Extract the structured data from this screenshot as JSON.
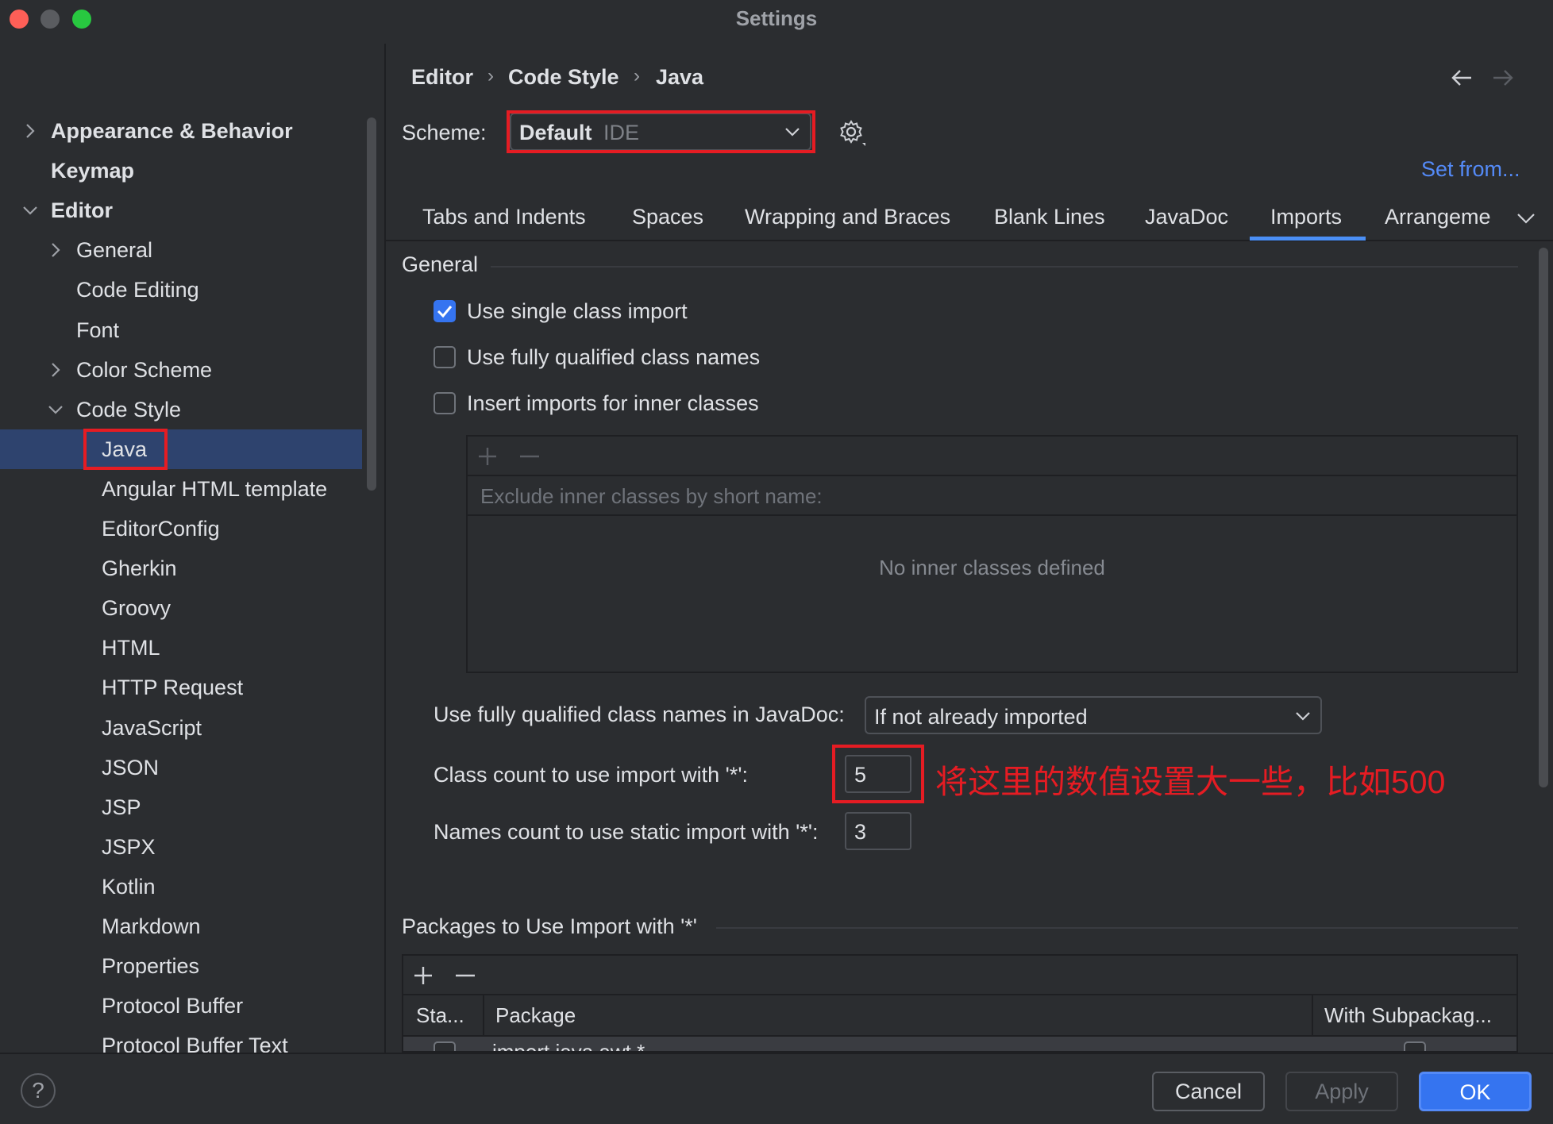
{
  "window": {
    "title": "Settings"
  },
  "colors": {
    "accent": "#3574f0",
    "link": "#548af7",
    "annotation_red": "#e51c23",
    "selection": "#2e436e"
  },
  "sidebar": {
    "search_icon": "search-icon",
    "items": [
      {
        "label": "Appearance & Behavior",
        "chevron": "right"
      },
      {
        "label": "Keymap",
        "chevron": ""
      },
      {
        "label": "Editor",
        "chevron": "down"
      },
      {
        "label": "General",
        "chevron": "right"
      },
      {
        "label": "Code Editing",
        "chevron": ""
      },
      {
        "label": "Font",
        "chevron": ""
      },
      {
        "label": "Color Scheme",
        "chevron": "right"
      },
      {
        "label": "Code Style",
        "chevron": "down"
      },
      {
        "label": "Java",
        "chevron": "",
        "selected": true
      },
      {
        "label": "Angular HTML template",
        "chevron": ""
      },
      {
        "label": "EditorConfig",
        "chevron": ""
      },
      {
        "label": "Gherkin",
        "chevron": ""
      },
      {
        "label": "Groovy",
        "chevron": ""
      },
      {
        "label": "HTML",
        "chevron": ""
      },
      {
        "label": "HTTP Request",
        "chevron": ""
      },
      {
        "label": "JavaScript",
        "chevron": ""
      },
      {
        "label": "JSON",
        "chevron": ""
      },
      {
        "label": "JSP",
        "chevron": ""
      },
      {
        "label": "JSPX",
        "chevron": ""
      },
      {
        "label": "Kotlin",
        "chevron": ""
      },
      {
        "label": "Markdown",
        "chevron": ""
      },
      {
        "label": "Properties",
        "chevron": ""
      },
      {
        "label": "Protocol Buffer",
        "chevron": ""
      },
      {
        "label": "Protocol Buffer Text",
        "chevron": ""
      }
    ]
  },
  "breadcrumb": {
    "items": [
      "Editor",
      "Code Style",
      "Java"
    ],
    "separator": "›"
  },
  "scheme": {
    "label": "Scheme:",
    "name": "Default",
    "kind": "IDE",
    "set_from": "Set from..."
  },
  "tabs": {
    "items": [
      "Tabs and Indents",
      "Spaces",
      "Wrapping and Braces",
      "Blank Lines",
      "JavaDoc",
      "Imports",
      "Arrangeme"
    ],
    "active": "Imports"
  },
  "general": {
    "title": "General",
    "checkboxes": [
      {
        "label": "Use single class import",
        "checked": true
      },
      {
        "label": "Use fully qualified class names",
        "checked": false
      },
      {
        "label": "Insert imports for inner classes",
        "checked": false
      }
    ],
    "inner_classes": {
      "header_placeholder": "Exclude inner classes by short name:",
      "empty_text": "No inner classes defined"
    },
    "javadoc": {
      "label": "Use fully qualified class names in JavaDoc:",
      "value": "If not already imported"
    },
    "class_count": {
      "label": "Class count to use import with '*':",
      "value": "5"
    },
    "names_count": {
      "label": "Names count to use static import with '*':",
      "value": "3"
    },
    "annotation": "将这里的数值设置大一些，比如500"
  },
  "packages": {
    "title": "Packages to Use Import with '*'",
    "columns": [
      "Sta...",
      "Package",
      "With Subpackag..."
    ],
    "rows": [
      {
        "package": "import java.awt.*"
      }
    ]
  },
  "footer": {
    "help": "?",
    "cancel": "Cancel",
    "apply": "Apply",
    "ok": "OK"
  }
}
